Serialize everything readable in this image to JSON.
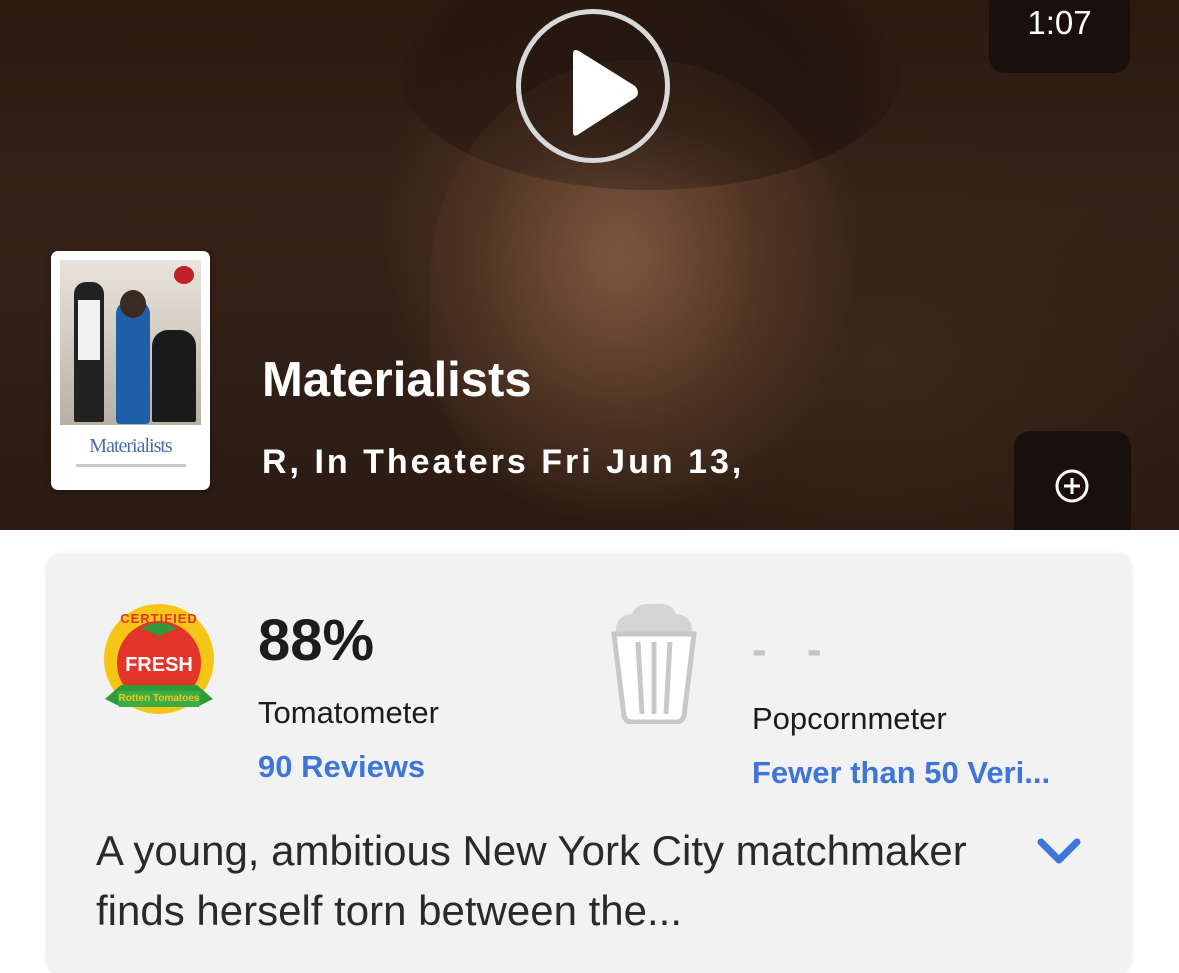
{
  "video": {
    "duration": "1:07",
    "play_icon": "play-icon"
  },
  "movie": {
    "title": "Materialists",
    "meta": "R, In Theaters Fri Jun 13,",
    "poster_title": "Materialists",
    "add_icon": "plus-circle-icon"
  },
  "scores": {
    "tomatometer": {
      "badge": "certified-fresh-icon",
      "badge_top_text": "CERTIFIED",
      "badge_mid_text": "FRESH",
      "badge_brand_text": "Rotten Tomatoes",
      "value": "88%",
      "label": "Tomatometer",
      "reviews_link": "90 Reviews"
    },
    "popcornmeter": {
      "icon": "empty-popcorn-bucket-icon",
      "value": "- -",
      "label": "Popcornmeter",
      "reviews_link": "Fewer than 50 Veri..."
    }
  },
  "synopsis": {
    "text": "A young, ambitious New York City matchmaker finds herself torn between the...",
    "expand_icon": "chevron-down-icon"
  },
  "colors": {
    "link": "#3f75d8",
    "fresh_red": "#e3342a",
    "fresh_yellow": "#f5c518",
    "fresh_green": "#2f9a3a",
    "card_bg": "#f2f2f2"
  }
}
